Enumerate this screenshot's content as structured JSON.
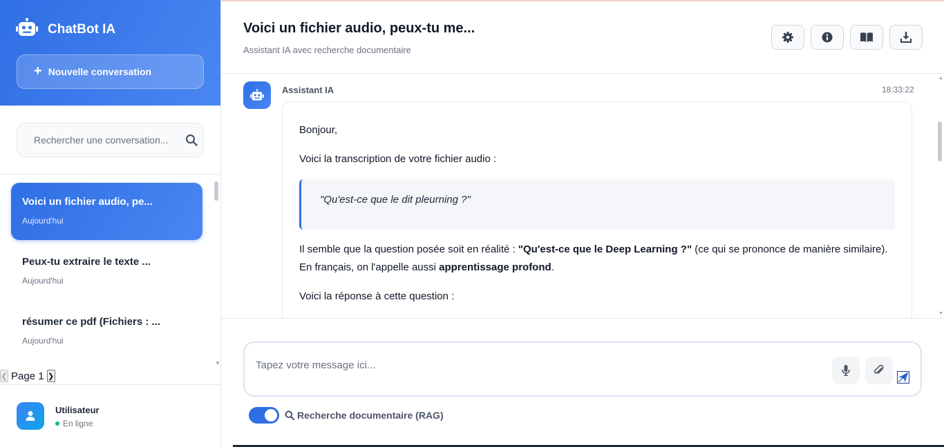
{
  "sidebar": {
    "brand_title": "ChatBot IA",
    "new_conversation_label": "Nouvelle conversation",
    "search_placeholder": "Rechercher une conversation...",
    "conversations": [
      {
        "title": "Voici un fichier audio, pe...",
        "date": "Aujourd'hui",
        "active": true
      },
      {
        "title": "Peux-tu extraire le texte ...",
        "date": "Aujourd'hui",
        "active": false
      },
      {
        "title": "résumer ce pdf (Fichiers : ...",
        "date": "Aujourd'hui",
        "active": false
      }
    ],
    "pagination": {
      "label": "Page 1"
    },
    "user": {
      "name": "Utilisateur",
      "status": "En ligne"
    }
  },
  "header": {
    "title": "Voici un fichier audio, peux-tu me...",
    "subtitle": "Assistant IA avec recherche documentaire",
    "actions": [
      "gear-icon",
      "info-icon",
      "book-icon",
      "download-icon"
    ]
  },
  "message": {
    "author": "Assistant IA",
    "time": "18:33:22",
    "greeting": "Bonjour,",
    "intro": "Voici la transcription de votre fichier audio :",
    "quote": "\"Qu'est-ce que le dit pleurning ?\"",
    "para_part1": "Il semble que la question posée soit en réalité : ",
    "para_bold1": "\"Qu'est-ce que le Deep Learning ?\"",
    "para_part2": " (ce qui se prononce de manière similaire). En français, on l'appelle aussi ",
    "para_bold2": "apprentissage profond",
    "para_part3": ".",
    "answer_intro": "Voici la réponse à cette question :"
  },
  "composer": {
    "placeholder": "Tapez votre message ici...",
    "rag_label": "Recherche documentaire (RAG)",
    "rag_enabled": true
  },
  "colors": {
    "accent": "#2f6fe4",
    "accent_light": "#4a86f3",
    "online": "#10b981"
  }
}
